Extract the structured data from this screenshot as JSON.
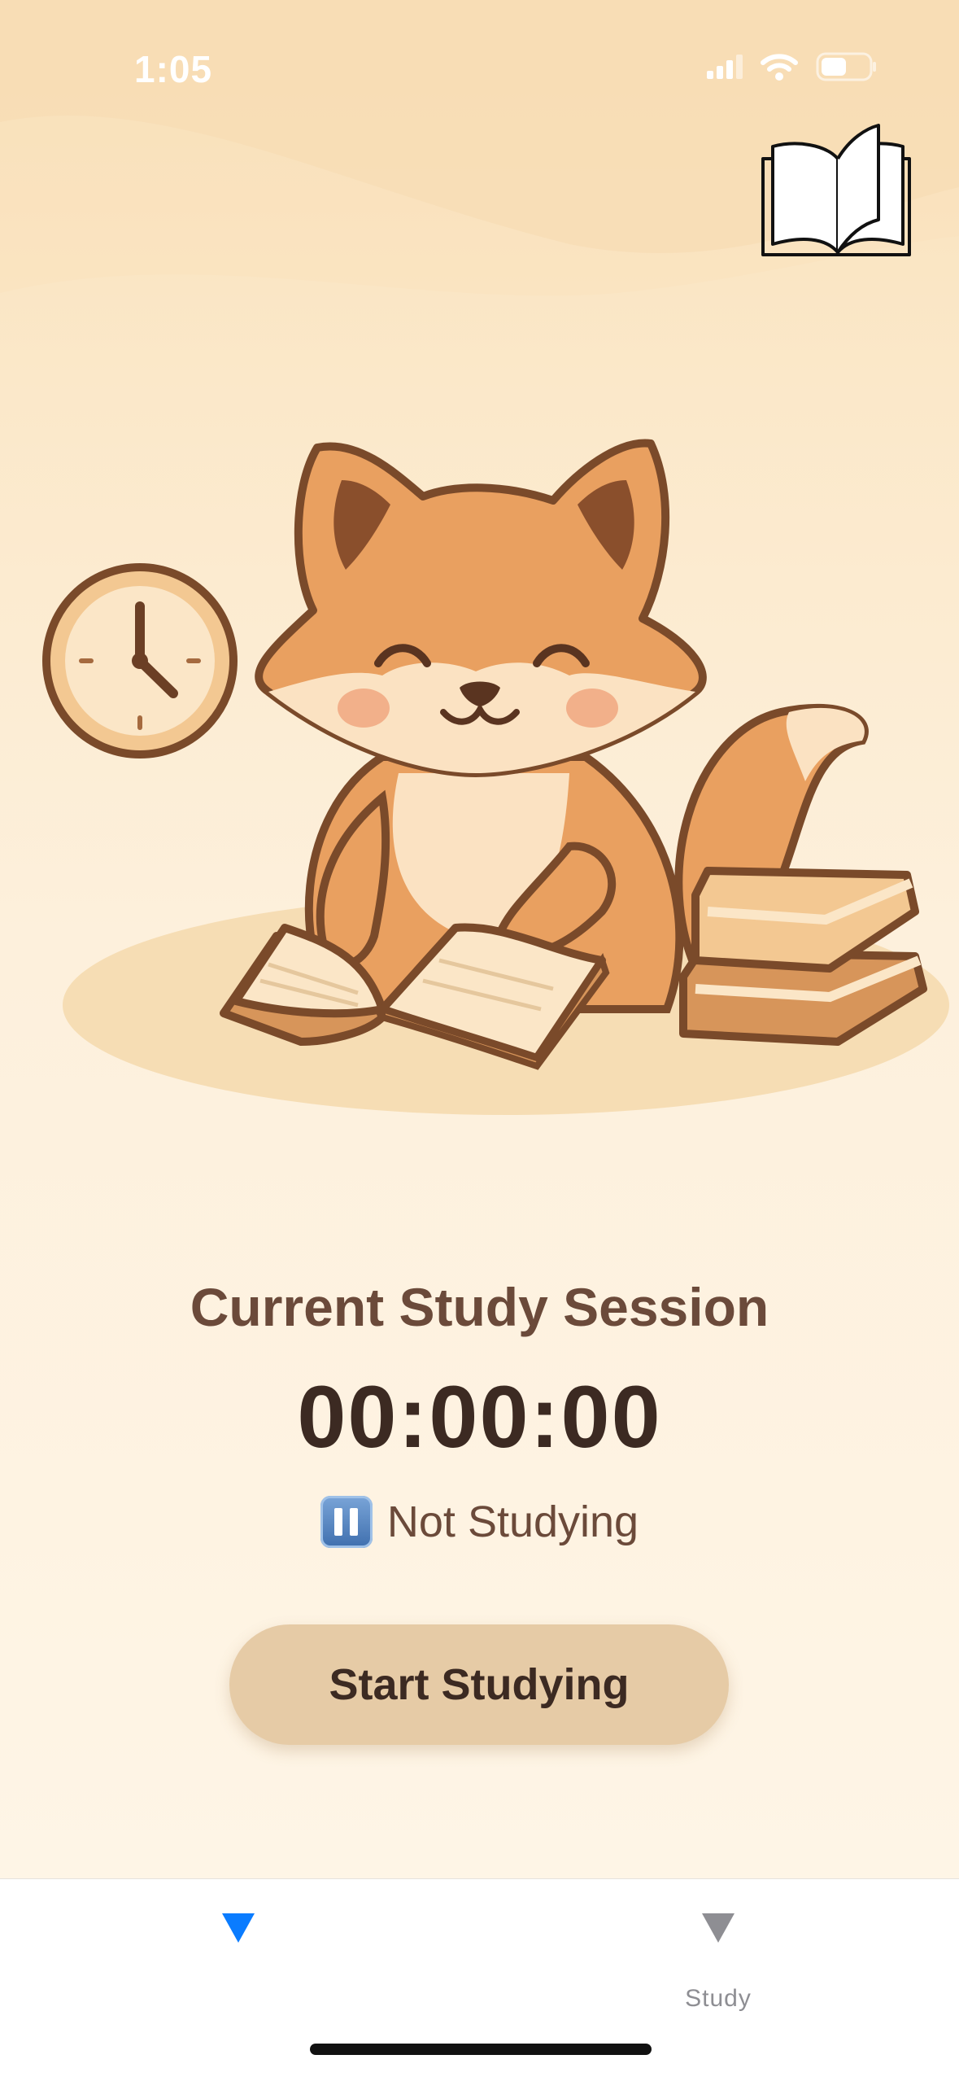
{
  "status_bar": {
    "time": "1:05"
  },
  "session": {
    "title": "Current Study Session",
    "timer": "00:00:00",
    "status_text": "Not Studying",
    "status_icon": "pause-icon"
  },
  "actions": {
    "start_label": "Start Studying"
  },
  "tab_bar": {
    "tabs": [
      {
        "label": "",
        "icon": "triangle-down-icon",
        "active": true,
        "color": "#0a7cff"
      },
      {
        "label": "Study",
        "icon": "triangle-down-icon",
        "active": false,
        "color": "#8e8e93"
      }
    ]
  },
  "colors": {
    "background_top": "#f8e0b8",
    "background_bottom": "#fef5e6",
    "accent_brown": "#6b4a3a",
    "button_fill": "#e6cba6",
    "fox_orange": "#e9a060"
  }
}
